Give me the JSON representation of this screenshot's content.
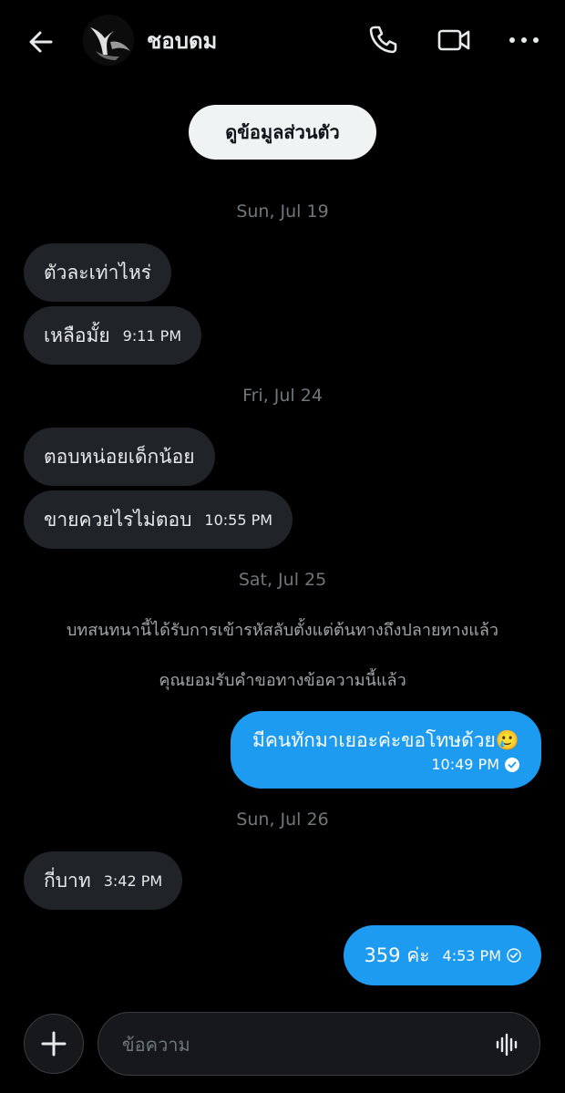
{
  "header": {
    "back_icon": "arrow-left-icon",
    "contact_name": "ชอบดม",
    "call_icon": "phone-icon",
    "video_icon": "video-camera-icon",
    "more_icon": "more-horizontal-icon"
  },
  "profile_button_label": "ดูข้อมูลส่วนตัว",
  "dates": {
    "d1": "Sun, Jul 19",
    "d2": "Fri, Jul 24",
    "d3": "Sat, Jul 25",
    "d4": "Sun, Jul 26"
  },
  "system_messages": {
    "encrypted": "บทสนทนานี้ได้รับการเข้ารหัสลับตั้งแต่ต้นทางถึงปลายทางแล้ว",
    "accepted": "คุณยอมรับคำขอทางข้อความนี้แล้ว"
  },
  "messages": [
    {
      "dir": "in",
      "text": "ตัวละเท่าไหร่",
      "time": ""
    },
    {
      "dir": "in",
      "text": "เหลือมั้ย",
      "time": "9:11 PM"
    },
    {
      "dir": "in",
      "text": "ตอบหน่อยเด็กน้อย",
      "time": ""
    },
    {
      "dir": "in",
      "text": "ขายควยไรไม่ตอบ",
      "time": "10:55 PM"
    },
    {
      "dir": "out",
      "text": "มีคนทักมาเยอะค่ะขอโทษด้วย🥲",
      "time": "10:49 PM",
      "status": "read"
    },
    {
      "dir": "in",
      "text": "กี่บาท",
      "time": "3:42 PM"
    },
    {
      "dir": "out",
      "text": "359 ค่ะ",
      "time": "4:53 PM",
      "status": "sent"
    }
  ],
  "compose": {
    "add_icon": "plus-icon",
    "placeholder": "ข้อความ",
    "voice_icon": "voice-waveform-icon"
  },
  "colors": {
    "background": "#000000",
    "incoming_bubble": "#202327",
    "outgoing_bubble": "#1d9bf0",
    "muted_text": "#71767b"
  }
}
